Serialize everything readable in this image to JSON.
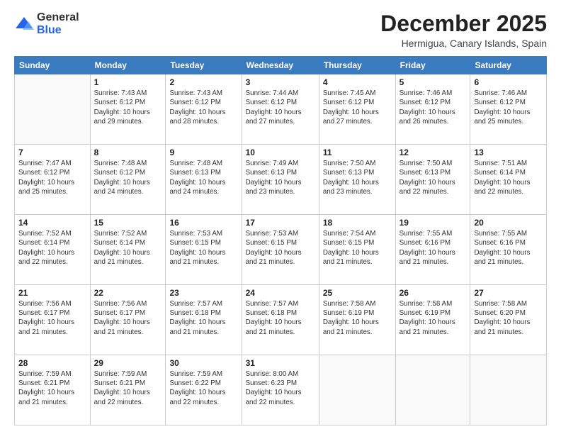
{
  "logo": {
    "general": "General",
    "blue": "Blue"
  },
  "header": {
    "title": "December 2025",
    "subtitle": "Hermigua, Canary Islands, Spain"
  },
  "days_of_week": [
    "Sunday",
    "Monday",
    "Tuesday",
    "Wednesday",
    "Thursday",
    "Friday",
    "Saturday"
  ],
  "weeks": [
    [
      {
        "day": "",
        "detail": ""
      },
      {
        "day": "1",
        "detail": "Sunrise: 7:43 AM\nSunset: 6:12 PM\nDaylight: 10 hours\nand 29 minutes."
      },
      {
        "day": "2",
        "detail": "Sunrise: 7:43 AM\nSunset: 6:12 PM\nDaylight: 10 hours\nand 28 minutes."
      },
      {
        "day": "3",
        "detail": "Sunrise: 7:44 AM\nSunset: 6:12 PM\nDaylight: 10 hours\nand 27 minutes."
      },
      {
        "day": "4",
        "detail": "Sunrise: 7:45 AM\nSunset: 6:12 PM\nDaylight: 10 hours\nand 27 minutes."
      },
      {
        "day": "5",
        "detail": "Sunrise: 7:46 AM\nSunset: 6:12 PM\nDaylight: 10 hours\nand 26 minutes."
      },
      {
        "day": "6",
        "detail": "Sunrise: 7:46 AM\nSunset: 6:12 PM\nDaylight: 10 hours\nand 25 minutes."
      }
    ],
    [
      {
        "day": "7",
        "detail": "Sunrise: 7:47 AM\nSunset: 6:12 PM\nDaylight: 10 hours\nand 25 minutes."
      },
      {
        "day": "8",
        "detail": "Sunrise: 7:48 AM\nSunset: 6:12 PM\nDaylight: 10 hours\nand 24 minutes."
      },
      {
        "day": "9",
        "detail": "Sunrise: 7:48 AM\nSunset: 6:13 PM\nDaylight: 10 hours\nand 24 minutes."
      },
      {
        "day": "10",
        "detail": "Sunrise: 7:49 AM\nSunset: 6:13 PM\nDaylight: 10 hours\nand 23 minutes."
      },
      {
        "day": "11",
        "detail": "Sunrise: 7:50 AM\nSunset: 6:13 PM\nDaylight: 10 hours\nand 23 minutes."
      },
      {
        "day": "12",
        "detail": "Sunrise: 7:50 AM\nSunset: 6:13 PM\nDaylight: 10 hours\nand 22 minutes."
      },
      {
        "day": "13",
        "detail": "Sunrise: 7:51 AM\nSunset: 6:14 PM\nDaylight: 10 hours\nand 22 minutes."
      }
    ],
    [
      {
        "day": "14",
        "detail": "Sunrise: 7:52 AM\nSunset: 6:14 PM\nDaylight: 10 hours\nand 22 minutes."
      },
      {
        "day": "15",
        "detail": "Sunrise: 7:52 AM\nSunset: 6:14 PM\nDaylight: 10 hours\nand 21 minutes."
      },
      {
        "day": "16",
        "detail": "Sunrise: 7:53 AM\nSunset: 6:15 PM\nDaylight: 10 hours\nand 21 minutes."
      },
      {
        "day": "17",
        "detail": "Sunrise: 7:53 AM\nSunset: 6:15 PM\nDaylight: 10 hours\nand 21 minutes."
      },
      {
        "day": "18",
        "detail": "Sunrise: 7:54 AM\nSunset: 6:15 PM\nDaylight: 10 hours\nand 21 minutes."
      },
      {
        "day": "19",
        "detail": "Sunrise: 7:55 AM\nSunset: 6:16 PM\nDaylight: 10 hours\nand 21 minutes."
      },
      {
        "day": "20",
        "detail": "Sunrise: 7:55 AM\nSunset: 6:16 PM\nDaylight: 10 hours\nand 21 minutes."
      }
    ],
    [
      {
        "day": "21",
        "detail": "Sunrise: 7:56 AM\nSunset: 6:17 PM\nDaylight: 10 hours\nand 21 minutes."
      },
      {
        "day": "22",
        "detail": "Sunrise: 7:56 AM\nSunset: 6:17 PM\nDaylight: 10 hours\nand 21 minutes."
      },
      {
        "day": "23",
        "detail": "Sunrise: 7:57 AM\nSunset: 6:18 PM\nDaylight: 10 hours\nand 21 minutes."
      },
      {
        "day": "24",
        "detail": "Sunrise: 7:57 AM\nSunset: 6:18 PM\nDaylight: 10 hours\nand 21 minutes."
      },
      {
        "day": "25",
        "detail": "Sunrise: 7:58 AM\nSunset: 6:19 PM\nDaylight: 10 hours\nand 21 minutes."
      },
      {
        "day": "26",
        "detail": "Sunrise: 7:58 AM\nSunset: 6:19 PM\nDaylight: 10 hours\nand 21 minutes."
      },
      {
        "day": "27",
        "detail": "Sunrise: 7:58 AM\nSunset: 6:20 PM\nDaylight: 10 hours\nand 21 minutes."
      }
    ],
    [
      {
        "day": "28",
        "detail": "Sunrise: 7:59 AM\nSunset: 6:21 PM\nDaylight: 10 hours\nand 21 minutes."
      },
      {
        "day": "29",
        "detail": "Sunrise: 7:59 AM\nSunset: 6:21 PM\nDaylight: 10 hours\nand 22 minutes."
      },
      {
        "day": "30",
        "detail": "Sunrise: 7:59 AM\nSunset: 6:22 PM\nDaylight: 10 hours\nand 22 minutes."
      },
      {
        "day": "31",
        "detail": "Sunrise: 8:00 AM\nSunset: 6:23 PM\nDaylight: 10 hours\nand 22 minutes."
      },
      {
        "day": "",
        "detail": ""
      },
      {
        "day": "",
        "detail": ""
      },
      {
        "day": "",
        "detail": ""
      }
    ]
  ]
}
